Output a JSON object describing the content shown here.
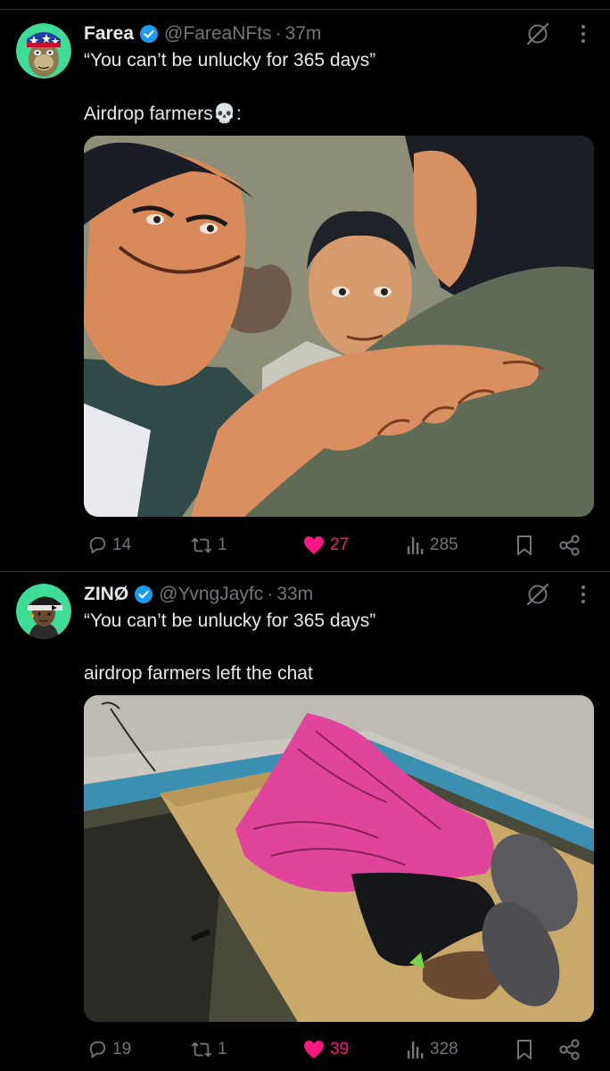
{
  "colors": {
    "background": "#000000",
    "text": "#e7e9ea",
    "muted": "#71767b",
    "verified": "#1d9bf0",
    "like": "#f91880",
    "divider": "#2f3336"
  },
  "tweets": [
    {
      "name": "Farea",
      "handle": "@FareaNFts",
      "separator": "·",
      "time": "37m",
      "line1": "“You can’t be unlucky for 365 days”",
      "line2": "Airdrop farmers💀:",
      "media_description": "cartoon-men-grinning-meme",
      "icons": [
        "verified-badge-icon",
        "grok-icon",
        "more-icon",
        "reply-icon",
        "retweet-icon",
        "like-icon",
        "views-icon",
        "bookmark-icon",
        "share-icon"
      ],
      "stats": {
        "replies": "14",
        "retweets": "1",
        "likes": "27",
        "views": "285"
      },
      "liked": true
    },
    {
      "name": "ZINØ",
      "handle": "@YvngJayfc",
      "separator": "·",
      "time": "33m",
      "line1": "“You can’t be unlucky for 365 days”",
      "line2": "airdrop farmers left the chat",
      "media_description": "person-under-pink-blanket-on-mattress",
      "icons": [
        "verified-badge-icon",
        "grok-icon",
        "more-icon",
        "reply-icon",
        "retweet-icon",
        "like-icon",
        "views-icon",
        "bookmark-icon",
        "share-icon"
      ],
      "stats": {
        "replies": "19",
        "retweets": "1",
        "likes": "39",
        "views": "328"
      },
      "liked": true
    }
  ]
}
